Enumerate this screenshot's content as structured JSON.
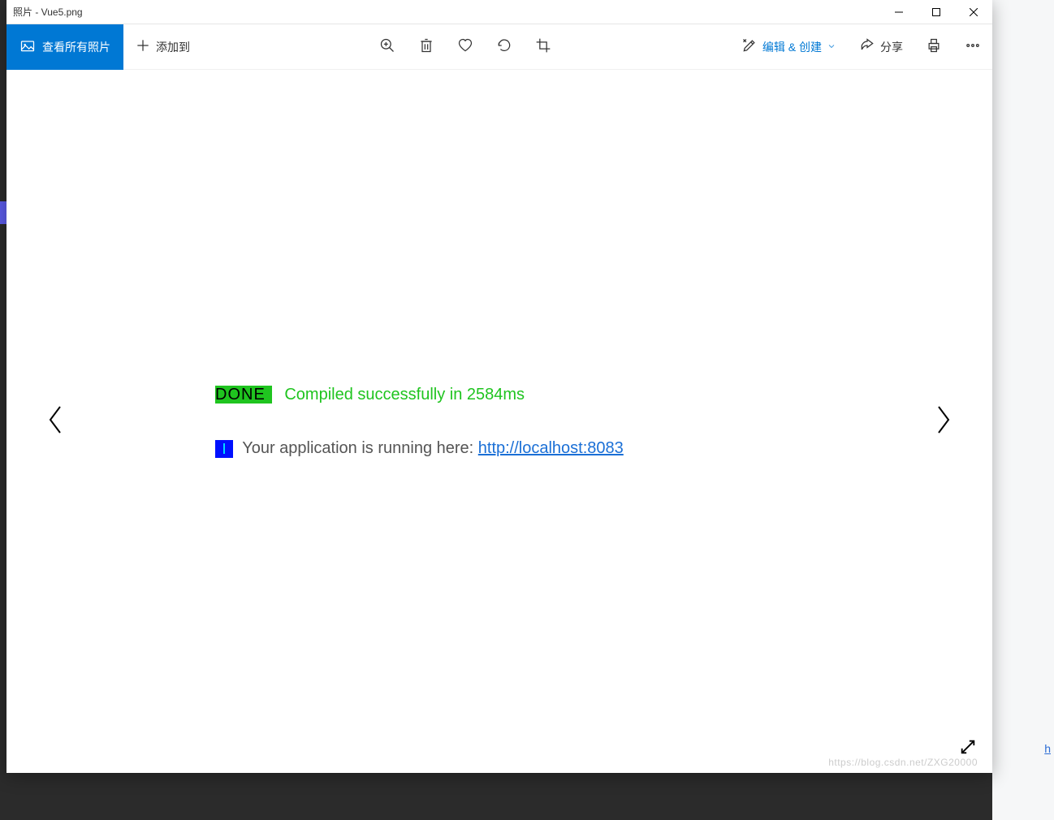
{
  "titlebar": {
    "title": "照片 - Vue5.png"
  },
  "toolbar": {
    "view_all": "查看所有照片",
    "add_to": "添加到",
    "edit_create": "编辑 & 创建",
    "share": "分享"
  },
  "content": {
    "done_badge": "DONE",
    "done_text": " Compiled successfully in 2584ms",
    "info_badge": "I",
    "run_text": " Your application is running here: ",
    "run_url": "http://localhost:8083"
  },
  "watermark": "https://blog.csdn.net/ZXG20000",
  "bg": {
    "link_fragment": "h"
  }
}
